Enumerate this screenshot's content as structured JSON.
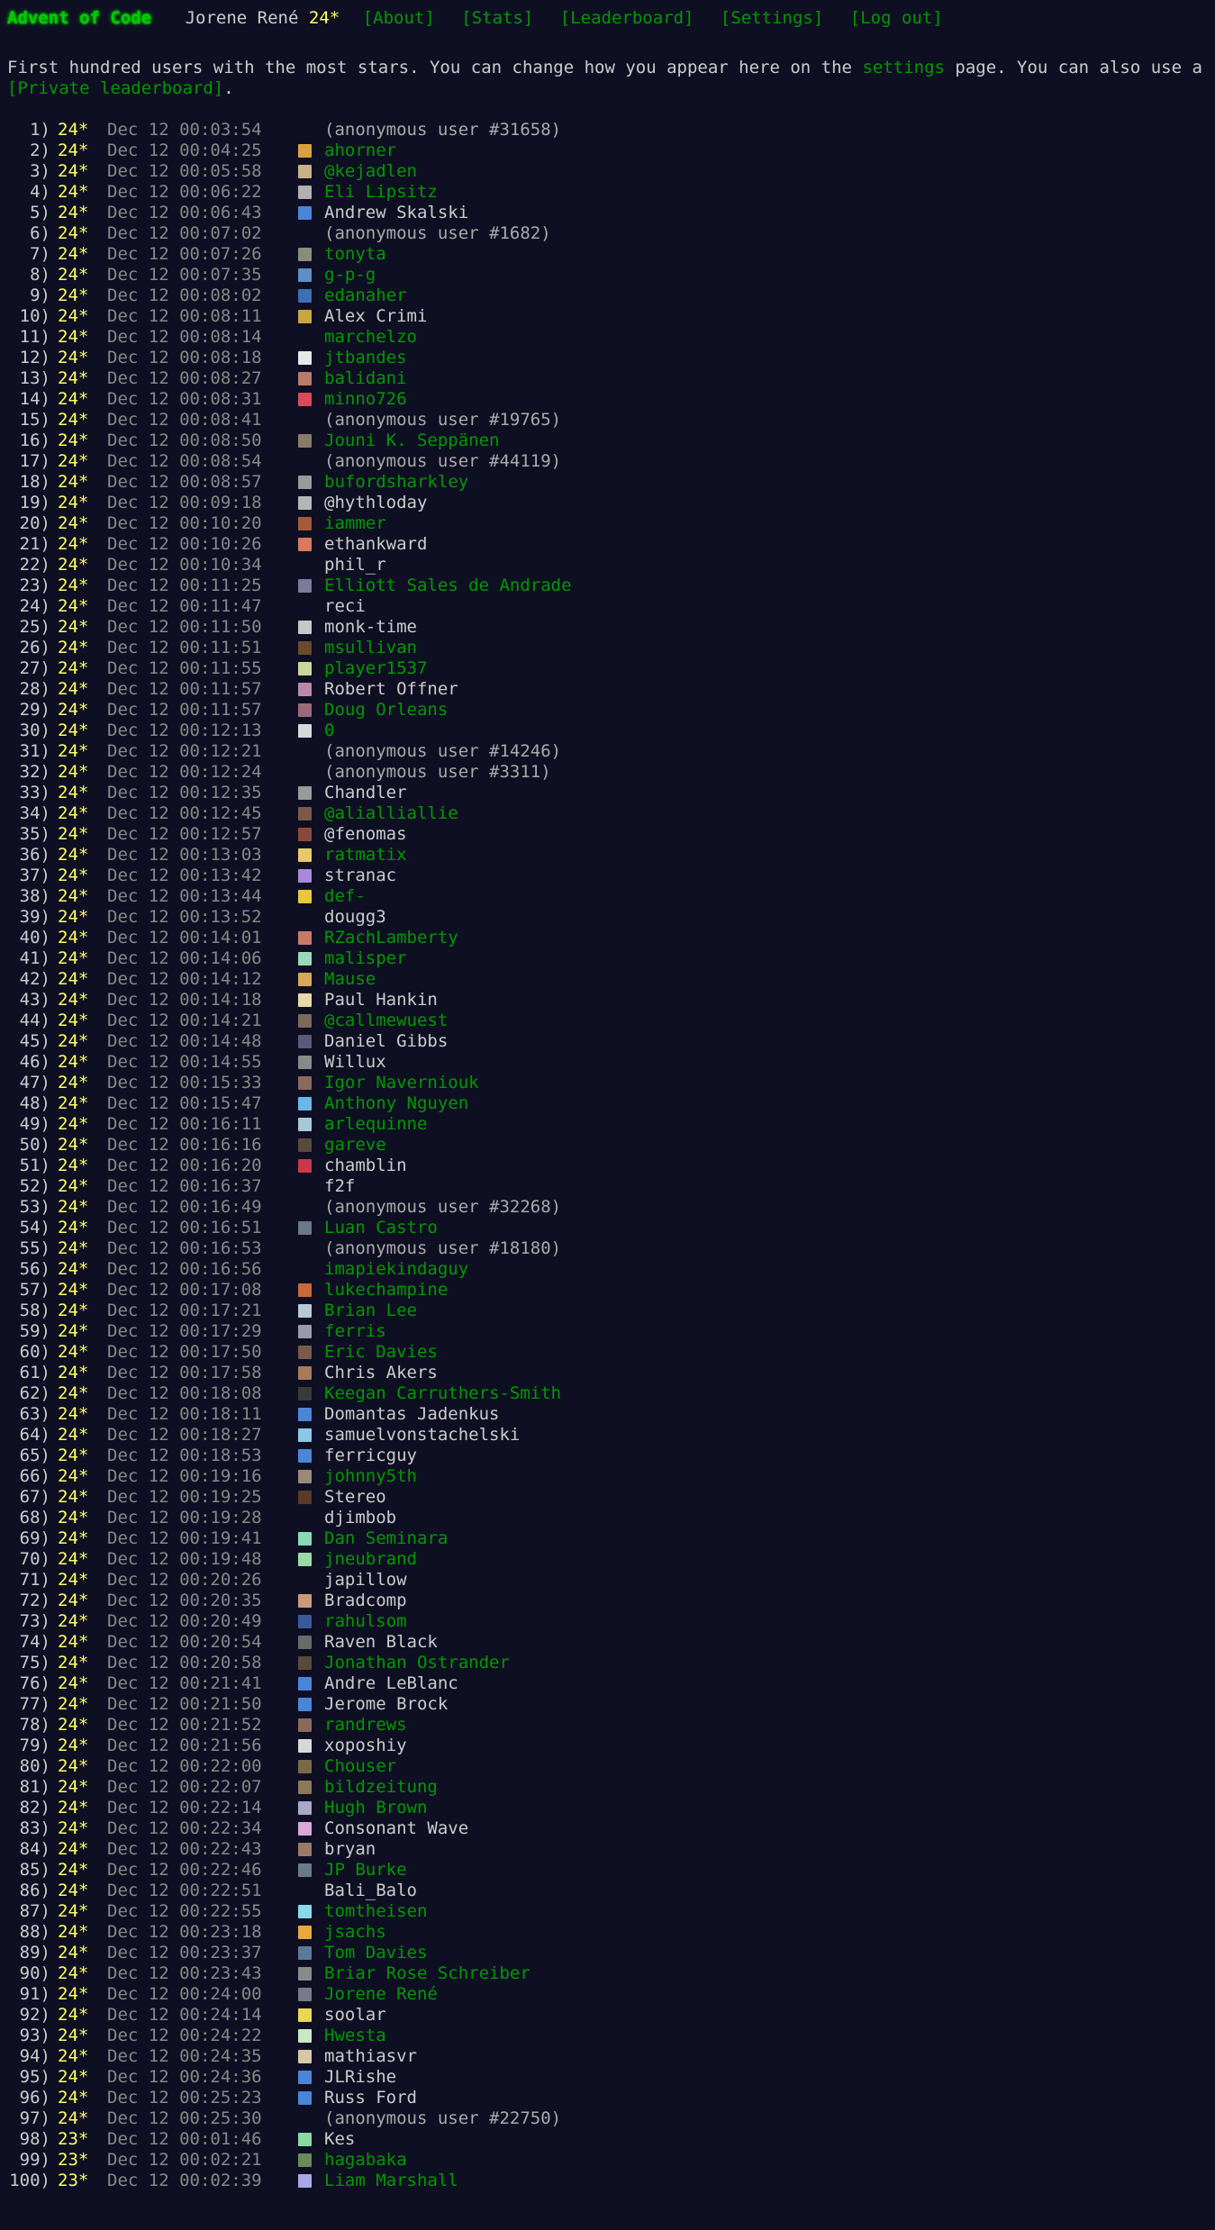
{
  "header": {
    "title": "Advent of Code",
    "user": "Jorene René",
    "stars": "24*",
    "nav": [
      "[About]",
      "[Stats]",
      "[Leaderboard]",
      "[Settings]",
      "[Log out]"
    ]
  },
  "intro": {
    "text_1": "First hundred users with the most stars. You can change how you appear here on the ",
    "settings_link": "settings",
    "text_2": " page. You can also use a ",
    "private_link": "[Private leaderboard]",
    "text_3": "."
  },
  "colors": {
    "background": "#0f0f23",
    "link": "#009900",
    "title": "#00cc00",
    "star": "#ffff66",
    "text": "#cccccc",
    "muted": "#888888"
  },
  "entries": [
    {
      "rank": "1)",
      "stars": "24*",
      "time": "Dec 12  00:03:54",
      "name": "(anonymous user #31658)",
      "kind": "anon",
      "avatar": ""
    },
    {
      "rank": "2)",
      "stars": "24*",
      "time": "Dec 12  00:04:25",
      "name": "ahorner",
      "kind": "link",
      "avatar": "#d9a13b"
    },
    {
      "rank": "3)",
      "stars": "24*",
      "time": "Dec 12  00:05:58",
      "name": "@kejadlen",
      "kind": "link",
      "avatar": "#c9b18a"
    },
    {
      "rank": "4)",
      "stars": "24*",
      "time": "Dec 12  00:06:22",
      "name": "Eli Lipsitz",
      "kind": "link",
      "avatar": "#b0b0b0"
    },
    {
      "rank": "5)",
      "stars": "24*",
      "time": "Dec 12  00:06:43",
      "name": "Andrew Skalski",
      "kind": "plain",
      "avatar": "#4a86d8"
    },
    {
      "rank": "6)",
      "stars": "24*",
      "time": "Dec 12  00:07:02",
      "name": "(anonymous user #1682)",
      "kind": "anon",
      "avatar": ""
    },
    {
      "rank": "7)",
      "stars": "24*",
      "time": "Dec 12  00:07:26",
      "name": "tonyta",
      "kind": "link",
      "avatar": "#8c8c7a"
    },
    {
      "rank": "8)",
      "stars": "24*",
      "time": "Dec 12  00:07:35",
      "name": "g-p-g",
      "kind": "link",
      "avatar": "#5a8fc7"
    },
    {
      "rank": "9)",
      "stars": "24*",
      "time": "Dec 12  00:08:02",
      "name": "edanaher",
      "kind": "link",
      "avatar": "#3b6fb6"
    },
    {
      "rank": "10)",
      "stars": "24*",
      "time": "Dec 12  00:08:11",
      "name": "Alex Crimi",
      "kind": "plain",
      "avatar": "#c9a640"
    },
    {
      "rank": "11)",
      "stars": "24*",
      "time": "Dec 12  00:08:14",
      "name": "marchelzo",
      "kind": "link",
      "avatar": ""
    },
    {
      "rank": "12)",
      "stars": "24*",
      "time": "Dec 12  00:08:18",
      "name": "jtbandes",
      "kind": "link",
      "avatar": "#e8e8e8"
    },
    {
      "rank": "13)",
      "stars": "24*",
      "time": "Dec 12  00:08:27",
      "name": "balidani",
      "kind": "link",
      "avatar": "#b87d6a"
    },
    {
      "rank": "14)",
      "stars": "24*",
      "time": "Dec 12  00:08:31",
      "name": "minno726",
      "kind": "link",
      "avatar": "#d94a5a"
    },
    {
      "rank": "15)",
      "stars": "24*",
      "time": "Dec 12  00:08:41",
      "name": "(anonymous user #19765)",
      "kind": "anon",
      "avatar": ""
    },
    {
      "rank": "16)",
      "stars": "24*",
      "time": "Dec 12  00:08:50",
      "name": "Jouni K. Seppänen",
      "kind": "link",
      "avatar": "#8a7a6a"
    },
    {
      "rank": "17)",
      "stars": "24*",
      "time": "Dec 12  00:08:54",
      "name": "(anonymous user #44119)",
      "kind": "anon",
      "avatar": ""
    },
    {
      "rank": "18)",
      "stars": "24*",
      "time": "Dec 12  00:08:57",
      "name": "bufordsharkley",
      "kind": "link",
      "avatar": "#9a9a9a"
    },
    {
      "rank": "19)",
      "stars": "24*",
      "time": "Dec 12  00:09:18",
      "name": "@hythloday",
      "kind": "plain",
      "avatar": "#b5b5b5"
    },
    {
      "rank": "20)",
      "stars": "24*",
      "time": "Dec 12  00:10:20",
      "name": "iammer",
      "kind": "link",
      "avatar": "#a55a3a"
    },
    {
      "rank": "21)",
      "stars": "24*",
      "time": "Dec 12  00:10:26",
      "name": "ethankward",
      "kind": "plain",
      "avatar": "#d87a5a"
    },
    {
      "rank": "22)",
      "stars": "24*",
      "time": "Dec 12  00:10:34",
      "name": "phil_r",
      "kind": "plain",
      "avatar": ""
    },
    {
      "rank": "23)",
      "stars": "24*",
      "time": "Dec 12  00:11:25",
      "name": "Elliott Sales de Andrade",
      "kind": "link",
      "avatar": "#7a7a9a"
    },
    {
      "rank": "24)",
      "stars": "24*",
      "time": "Dec 12  00:11:47",
      "name": "reci",
      "kind": "plain",
      "avatar": ""
    },
    {
      "rank": "25)",
      "stars": "24*",
      "time": "Dec 12  00:11:50",
      "name": "monk-time",
      "kind": "plain",
      "avatar": "#c8c8c8"
    },
    {
      "rank": "26)",
      "stars": "24*",
      "time": "Dec 12  00:11:51",
      "name": "msullivan",
      "kind": "link",
      "avatar": "#6a4a2a"
    },
    {
      "rank": "27)",
      "stars": "24*",
      "time": "Dec 12  00:11:55",
      "name": "player1537",
      "kind": "link",
      "avatar": "#c8d89a"
    },
    {
      "rank": "28)",
      "stars": "24*",
      "time": "Dec 12  00:11:57",
      "name": "Robert Offner",
      "kind": "plain",
      "avatar": "#b88aa8"
    },
    {
      "rank": "29)",
      "stars": "24*",
      "time": "Dec 12  00:11:57",
      "name": "Doug Orleans",
      "kind": "link",
      "avatar": "#9a6a7a"
    },
    {
      "rank": "30)",
      "stars": "24*",
      "time": "Dec 12  00:12:13",
      "name": "0",
      "kind": "link",
      "avatar": "#d8d8d8"
    },
    {
      "rank": "31)",
      "stars": "24*",
      "time": "Dec 12  00:12:21",
      "name": "(anonymous user #14246)",
      "kind": "anon",
      "avatar": ""
    },
    {
      "rank": "32)",
      "stars": "24*",
      "time": "Dec 12  00:12:24",
      "name": "(anonymous user #3311)",
      "kind": "anon",
      "avatar": ""
    },
    {
      "rank": "33)",
      "stars": "24*",
      "time": "Dec 12  00:12:35",
      "name": "Chandler",
      "kind": "plain",
      "avatar": "#9a9a9a"
    },
    {
      "rank": "34)",
      "stars": "24*",
      "time": "Dec 12  00:12:45",
      "name": "@alialliallie",
      "kind": "link",
      "avatar": "#7a5a4a"
    },
    {
      "rank": "35)",
      "stars": "24*",
      "time": "Dec 12  00:12:57",
      "name": "@fenomas",
      "kind": "plain",
      "avatar": "#8a4a3a"
    },
    {
      "rank": "36)",
      "stars": "24*",
      "time": "Dec 12  00:13:03",
      "name": "ratmatix",
      "kind": "link",
      "avatar": "#e8c86a"
    },
    {
      "rank": "37)",
      "stars": "24*",
      "time": "Dec 12  00:13:42",
      "name": "stranac",
      "kind": "plain",
      "avatar": "#a88ad8"
    },
    {
      "rank": "38)",
      "stars": "24*",
      "time": "Dec 12  00:13:44",
      "name": "def-",
      "kind": "link",
      "avatar": "#e8c83a"
    },
    {
      "rank": "39)",
      "stars": "24*",
      "time": "Dec 12  00:13:52",
      "name": "dougg3",
      "kind": "plain",
      "avatar": ""
    },
    {
      "rank": "40)",
      "stars": "24*",
      "time": "Dec 12  00:14:01",
      "name": "RZachLamberty",
      "kind": "link",
      "avatar": "#c87a6a"
    },
    {
      "rank": "41)",
      "stars": "24*",
      "time": "Dec 12  00:14:06",
      "name": "malisper",
      "kind": "link",
      "avatar": "#9ad8b8"
    },
    {
      "rank": "42)",
      "stars": "24*",
      "time": "Dec 12  00:14:12",
      "name": "Mause",
      "kind": "link",
      "avatar": "#d8a85a"
    },
    {
      "rank": "43)",
      "stars": "24*",
      "time": "Dec 12  00:14:18",
      "name": "Paul Hankin",
      "kind": "plain",
      "avatar": "#e8d8a8"
    },
    {
      "rank": "44)",
      "stars": "24*",
      "time": "Dec 12  00:14:21",
      "name": "@callmewuest",
      "kind": "link",
      "avatar": "#7a6a5a"
    },
    {
      "rank": "45)",
      "stars": "24*",
      "time": "Dec 12  00:14:48",
      "name": "Daniel Gibbs",
      "kind": "plain",
      "avatar": "#5a5a7a"
    },
    {
      "rank": "46)",
      "stars": "24*",
      "time": "Dec 12  00:14:55",
      "name": "Willux",
      "kind": "plain",
      "avatar": "#8a8a8a"
    },
    {
      "rank": "47)",
      "stars": "24*",
      "time": "Dec 12  00:15:33",
      "name": "Igor Naverniouk",
      "kind": "link",
      "avatar": "#8a6a5a"
    },
    {
      "rank": "48)",
      "stars": "24*",
      "time": "Dec 12  00:15:47",
      "name": "Anthony Nguyen",
      "kind": "link",
      "avatar": "#6ab8e8"
    },
    {
      "rank": "49)",
      "stars": "24*",
      "time": "Dec 12  00:16:11",
      "name": "arlequinne",
      "kind": "link",
      "avatar": "#a8c8d8"
    },
    {
      "rank": "50)",
      "stars": "24*",
      "time": "Dec 12  00:16:16",
      "name": "gareve",
      "kind": "link",
      "avatar": "#5a4a3a"
    },
    {
      "rank": "51)",
      "stars": "24*",
      "time": "Dec 12  00:16:20",
      "name": "chamblin",
      "kind": "plain",
      "avatar": "#c83a4a"
    },
    {
      "rank": "52)",
      "stars": "24*",
      "time": "Dec 12  00:16:37",
      "name": "f2f",
      "kind": "plain",
      "avatar": ""
    },
    {
      "rank": "53)",
      "stars": "24*",
      "time": "Dec 12  00:16:49",
      "name": "(anonymous user #32268)",
      "kind": "anon",
      "avatar": ""
    },
    {
      "rank": "54)",
      "stars": "24*",
      "time": "Dec 12  00:16:51",
      "name": "Luan Castro",
      "kind": "link",
      "avatar": "#6a7a8a"
    },
    {
      "rank": "55)",
      "stars": "24*",
      "time": "Dec 12  00:16:53",
      "name": "(anonymous user #18180)",
      "kind": "anon",
      "avatar": ""
    },
    {
      "rank": "56)",
      "stars": "24*",
      "time": "Dec 12  00:16:56",
      "name": "imapiekindaguy",
      "kind": "link",
      "avatar": ""
    },
    {
      "rank": "57)",
      "stars": "24*",
      "time": "Dec 12  00:17:08",
      "name": "lukechampine",
      "kind": "link",
      "avatar": "#c86a3a"
    },
    {
      "rank": "58)",
      "stars": "24*",
      "time": "Dec 12  00:17:21",
      "name": "Brian Lee",
      "kind": "link",
      "avatar": "#b8c8d8"
    },
    {
      "rank": "59)",
      "stars": "24*",
      "time": "Dec 12  00:17:29",
      "name": "ferris",
      "kind": "link",
      "avatar": "#9a9aaa"
    },
    {
      "rank": "60)",
      "stars": "24*",
      "time": "Dec 12  00:17:50",
      "name": "Eric Davies",
      "kind": "link",
      "avatar": "#7a5a4a"
    },
    {
      "rank": "61)",
      "stars": "24*",
      "time": "Dec 12  00:17:58",
      "name": "Chris Akers",
      "kind": "plain",
      "avatar": "#a87a5a"
    },
    {
      "rank": "62)",
      "stars": "24*",
      "time": "Dec 12  00:18:08",
      "name": "Keegan Carruthers-Smith",
      "kind": "link",
      "avatar": "#3a3a3a"
    },
    {
      "rank": "63)",
      "stars": "24*",
      "time": "Dec 12  00:18:11",
      "name": "Domantas Jadenkus",
      "kind": "plain",
      "avatar": "#4a86d8"
    },
    {
      "rank": "64)",
      "stars": "24*",
      "time": "Dec 12  00:18:27",
      "name": "samuelvonstachelski",
      "kind": "plain",
      "avatar": "#8ac8e8"
    },
    {
      "rank": "65)",
      "stars": "24*",
      "time": "Dec 12  00:18:53",
      "name": "ferricguy",
      "kind": "plain",
      "avatar": "#4a86d8"
    },
    {
      "rank": "66)",
      "stars": "24*",
      "time": "Dec 12  00:19:16",
      "name": "johnny5th",
      "kind": "link",
      "avatar": "#9a8a7a"
    },
    {
      "rank": "67)",
      "stars": "24*",
      "time": "Dec 12  00:19:25",
      "name": "Stereo",
      "kind": "plain",
      "avatar": "#5a3a2a"
    },
    {
      "rank": "68)",
      "stars": "24*",
      "time": "Dec 12  00:19:28",
      "name": "djimbob",
      "kind": "plain",
      "avatar": ""
    },
    {
      "rank": "69)",
      "stars": "24*",
      "time": "Dec 12  00:19:41",
      "name": "Dan Seminara",
      "kind": "link",
      "avatar": "#8ad8b8"
    },
    {
      "rank": "70)",
      "stars": "24*",
      "time": "Dec 12  00:19:48",
      "name": "jneubrand",
      "kind": "link",
      "avatar": "#9ad8a8"
    },
    {
      "rank": "71)",
      "stars": "24*",
      "time": "Dec 12  00:20:26",
      "name": "japillow",
      "kind": "plain",
      "avatar": ""
    },
    {
      "rank": "72)",
      "stars": "24*",
      "time": "Dec 12  00:20:35",
      "name": "Bradcomp",
      "kind": "plain",
      "avatar": "#c89a7a"
    },
    {
      "rank": "73)",
      "stars": "24*",
      "time": "Dec 12  00:20:49",
      "name": "rahulsom",
      "kind": "link",
      "avatar": "#3a5a9a"
    },
    {
      "rank": "74)",
      "stars": "24*",
      "time": "Dec 12  00:20:54",
      "name": "Raven Black",
      "kind": "plain",
      "avatar": "#6a6a6a"
    },
    {
      "rank": "75)",
      "stars": "24*",
      "time": "Dec 12  00:20:58",
      "name": "Jonathan Ostrander",
      "kind": "link",
      "avatar": "#5a4a3a"
    },
    {
      "rank": "76)",
      "stars": "24*",
      "time": "Dec 12  00:21:41",
      "name": "Andre LeBlanc",
      "kind": "plain",
      "avatar": "#4a86d8"
    },
    {
      "rank": "77)",
      "stars": "24*",
      "time": "Dec 12  00:21:50",
      "name": "Jerome Brock",
      "kind": "plain",
      "avatar": "#4a86d8"
    },
    {
      "rank": "78)",
      "stars": "24*",
      "time": "Dec 12  00:21:52",
      "name": "randrews",
      "kind": "link",
      "avatar": "#8a6a5a"
    },
    {
      "rank": "79)",
      "stars": "24*",
      "time": "Dec 12  00:21:56",
      "name": "xoposhiy",
      "kind": "plain",
      "avatar": "#d8d8d8"
    },
    {
      "rank": "80)",
      "stars": "24*",
      "time": "Dec 12  00:22:00",
      "name": "Chouser",
      "kind": "link",
      "avatar": "#7a6a4a"
    },
    {
      "rank": "81)",
      "stars": "24*",
      "time": "Dec 12  00:22:07",
      "name": "bildzeitung",
      "kind": "link",
      "avatar": "#8a7a5a"
    },
    {
      "rank": "82)",
      "stars": "24*",
      "time": "Dec 12  00:22:14",
      "name": "Hugh Brown",
      "kind": "link",
      "avatar": "#a8a8c8"
    },
    {
      "rank": "83)",
      "stars": "24*",
      "time": "Dec 12  00:22:34",
      "name": "Consonant Wave",
      "kind": "plain",
      "avatar": "#d8a8d8"
    },
    {
      "rank": "84)",
      "stars": "24*",
      "time": "Dec 12  00:22:43",
      "name": "bryan",
      "kind": "plain",
      "avatar": "#9a7a6a"
    },
    {
      "rank": "85)",
      "stars": "24*",
      "time": "Dec 12  00:22:46",
      "name": "JP Burke",
      "kind": "link",
      "avatar": "#6a7a8a"
    },
    {
      "rank": "86)",
      "stars": "24*",
      "time": "Dec 12  00:22:51",
      "name": "Bali_Balo",
      "kind": "plain",
      "avatar": ""
    },
    {
      "rank": "87)",
      "stars": "24*",
      "time": "Dec 12  00:22:55",
      "name": "tomtheisen",
      "kind": "link",
      "avatar": "#8ad8e8"
    },
    {
      "rank": "88)",
      "stars": "24*",
      "time": "Dec 12  00:23:18",
      "name": "jsachs",
      "kind": "link",
      "avatar": "#e8a83a"
    },
    {
      "rank": "89)",
      "stars": "24*",
      "time": "Dec 12  00:23:37",
      "name": "Tom Davies",
      "kind": "link",
      "avatar": "#5a7a9a"
    },
    {
      "rank": "90)",
      "stars": "24*",
      "time": "Dec 12  00:23:43",
      "name": "Briar Rose Schreiber",
      "kind": "link",
      "avatar": "#8a8a8a"
    },
    {
      "rank": "91)",
      "stars": "24*",
      "time": "Dec 12  00:24:00",
      "name": "Jorene René",
      "kind": "link",
      "avatar": "#7a7a8a"
    },
    {
      "rank": "92)",
      "stars": "24*",
      "time": "Dec 12  00:24:14",
      "name": "soolar",
      "kind": "plain",
      "avatar": "#e8d85a"
    },
    {
      "rank": "93)",
      "stars": "24*",
      "time": "Dec 12  00:24:22",
      "name": "Hwesta",
      "kind": "link",
      "avatar": "#c8e8c8"
    },
    {
      "rank": "94)",
      "stars": "24*",
      "time": "Dec 12  00:24:35",
      "name": "mathiasvr",
      "kind": "plain",
      "avatar": "#d8c8a8"
    },
    {
      "rank": "95)",
      "stars": "24*",
      "time": "Dec 12  00:24:36",
      "name": "JLRishe",
      "kind": "plain",
      "avatar": "#4a86d8"
    },
    {
      "rank": "96)",
      "stars": "24*",
      "time": "Dec 12  00:25:23",
      "name": "Russ Ford",
      "kind": "plain",
      "avatar": "#4a86d8"
    },
    {
      "rank": "97)",
      "stars": "24*",
      "time": "Dec 12  00:25:30",
      "name": "(anonymous user #22750)",
      "kind": "anon",
      "avatar": ""
    },
    {
      "rank": "98)",
      "stars": "23*",
      "time": "Dec 12  00:01:46",
      "name": "Kes",
      "kind": "plain",
      "avatar": "#8ad8a8"
    },
    {
      "rank": "99)",
      "stars": "23*",
      "time": "Dec 12  00:02:21",
      "name": "hagabaka",
      "kind": "link",
      "avatar": "#6a8a5a"
    },
    {
      "rank": "100)",
      "stars": "23*",
      "time": "Dec 12  00:02:39",
      "name": "Liam Marshall",
      "kind": "link",
      "avatar": "#a8a8e8"
    }
  ]
}
